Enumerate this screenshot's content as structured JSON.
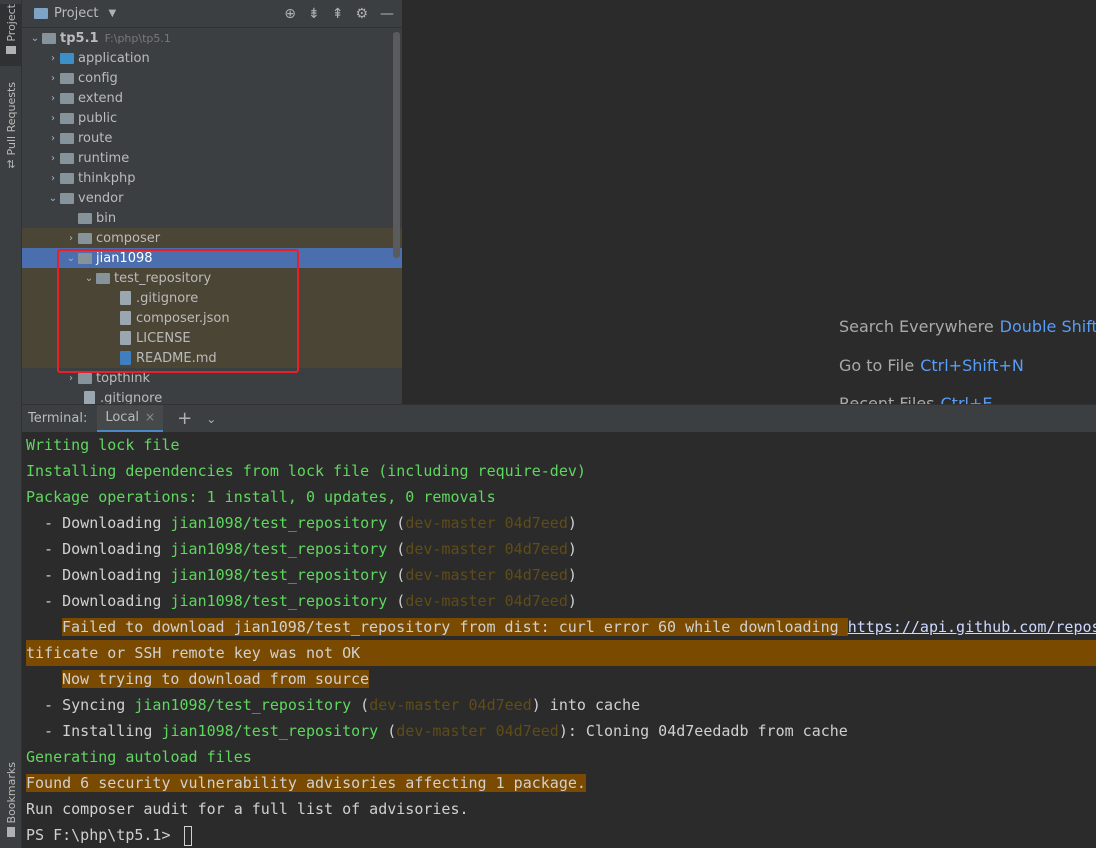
{
  "side_tabs": {
    "project": "Project",
    "pull_requests": "Pull Requests",
    "bookmarks": "Bookmarks"
  },
  "project_panel": {
    "title": "Project",
    "tree": [
      {
        "label": "tp5.1",
        "path": "F:\\php\\tp5.1"
      },
      {
        "label": "application"
      },
      {
        "label": "config"
      },
      {
        "label": "extend"
      },
      {
        "label": "public"
      },
      {
        "label": "route"
      },
      {
        "label": "runtime"
      },
      {
        "label": "thinkphp"
      },
      {
        "label": "vendor"
      },
      {
        "label": "bin"
      },
      {
        "label": "composer"
      },
      {
        "label": "jian1098"
      },
      {
        "label": "test_repository"
      },
      {
        "label": ".gitignore"
      },
      {
        "label": "composer.json"
      },
      {
        "label": "LICENSE"
      },
      {
        "label": "README.md"
      },
      {
        "label": "topthink"
      },
      {
        "label": ".gitignore"
      }
    ]
  },
  "editor_hints": [
    {
      "text": "Search Everywhere",
      "key": "Double Shift"
    },
    {
      "text": "Go to File",
      "key": "Ctrl+Shift+N"
    },
    {
      "text": "Recent Files",
      "key": "Ctrl+E"
    }
  ],
  "terminal": {
    "label": "Terminal:",
    "tab": "Local",
    "lines": {
      "l1": "Writing lock file",
      "l2": "Installing dependencies from lock file (including require-dev)",
      "l3": "Package operations: 1 install, 0 updates, 0 removals",
      "dl_prefix": "  - Downloading ",
      "pkg": "jian1098/test_repository",
      "ver_open": " (",
      "ver": "dev-master 04d7eed",
      "ver_close": ")",
      "fail_a": "Failed to download jian1098/test_repository from dist: curl error 60 while downloading ",
      "fail_link": "https://api.github.com/repos",
      "fail_b": "tificate or SSH remote key was not OK",
      "now_trying": "Now trying to download from source",
      "sync_prefix": "  - Syncing ",
      "sync_suffix": " into cache",
      "inst_prefix": "  - Installing ",
      "inst_suffix": ": Cloning 04d7eedadb from cache",
      "gen": "Generating autoload files",
      "found": "Found 6 security vulnerability advisories affecting 1 package.",
      "run": "Run composer audit for a full list of advisories.",
      "prompt": "PS F:\\php\\tp5.1> "
    }
  }
}
